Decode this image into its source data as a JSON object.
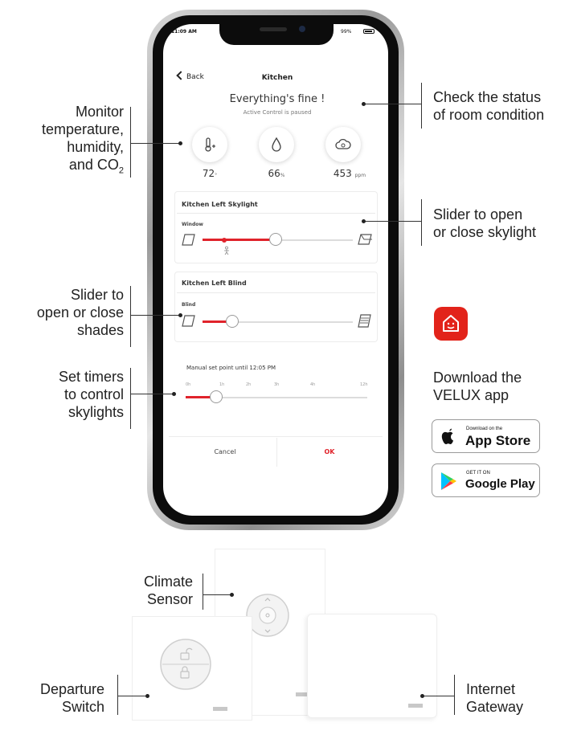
{
  "phone": {
    "status_time": "11:09 AM",
    "status_right": "99%",
    "back_label": "Back",
    "title": "Kitchen",
    "headline": "Everything's fine !",
    "subline": "Active Control is paused",
    "sensors": [
      {
        "icon": "thermometer-icon",
        "value": "72",
        "unit": "°"
      },
      {
        "icon": "humidity-drop-icon",
        "value": "66",
        "unit": "%"
      },
      {
        "icon": "co2-cloud-icon",
        "value": "453",
        "unit": "ppm"
      }
    ],
    "skylight_card": {
      "title": "Kitchen Left Skylight",
      "sub": "Window",
      "position": 0.45
    },
    "blind_card": {
      "title": "Kitchen Left Blind",
      "sub": "Blind",
      "position": 0.15
    },
    "timer": {
      "label": "Manual set point until 12:05 PM",
      "ticks": [
        "0h",
        "1h",
        "2h",
        "3h",
        "4h",
        "12h"
      ],
      "position": 0.2
    },
    "cancel_label": "Cancel",
    "ok_label": "OK"
  },
  "annotations": {
    "monitor": [
      "Monitor",
      "temperature,",
      "humidity,",
      "and CO"
    ],
    "monitor_sub": "2",
    "status": [
      "Check the status",
      "of room condition"
    ],
    "skylight": [
      "Slider to open",
      "or close skylight"
    ],
    "shades": [
      "Slider to",
      "open or close",
      "shades"
    ],
    "timers": [
      "Set timers",
      "to control",
      "skylights"
    ],
    "download": [
      "Download the",
      "VELUX app"
    ],
    "climate": [
      "Climate",
      "Sensor"
    ],
    "departure": [
      "Departure",
      "Switch"
    ],
    "gateway": [
      "Internet",
      "Gateway"
    ]
  },
  "badges": {
    "appstore_small": "Download on the",
    "appstore_big": "App Store",
    "play_small": "GET IT ON",
    "play_big": "Google Play"
  },
  "colors": {
    "accent": "#e0232b",
    "app_icon": "#e2231a"
  }
}
